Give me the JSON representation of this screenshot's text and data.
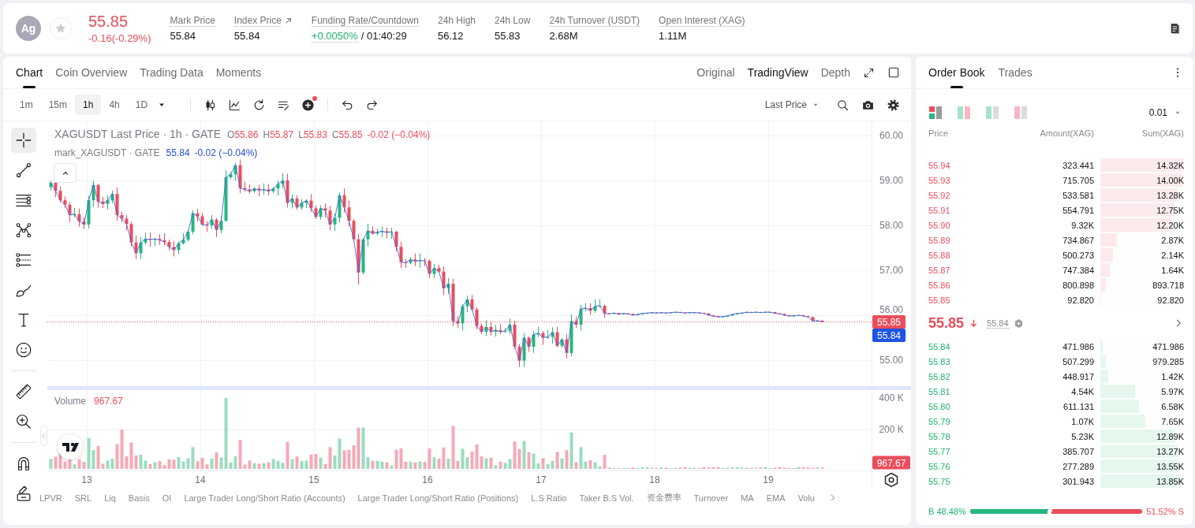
{
  "ticker": {
    "symbol": "Ag",
    "favorited": false,
    "price": "55.85",
    "change": "-0.16(-0.29%)",
    "falling": true
  },
  "stats": [
    {
      "label": "Mark Price",
      "value": "55.84",
      "tooltip": true,
      "kind": "plain"
    },
    {
      "label": "Index Price",
      "value": "55.84",
      "tooltip": true,
      "kind": "link"
    },
    {
      "label": "Funding Rate/Countdown",
      "value": "+0.0050%",
      "countdown": "/ 01:40:29",
      "tooltip": true,
      "kind": "funding"
    },
    {
      "label": "24h High",
      "value": "56.12",
      "tooltip": false,
      "kind": "plain"
    },
    {
      "label": "24h Low",
      "value": "55.83",
      "tooltip": false,
      "kind": "plain"
    },
    {
      "label": "24h Turnover (USDT)",
      "value": "2.68M",
      "tooltip": true,
      "kind": "plain"
    },
    {
      "label": "Open Interest (XAG)",
      "value": "1.11M",
      "tooltip": true,
      "kind": "plain"
    }
  ],
  "chart": {
    "tabs": [
      {
        "label": "Chart",
        "selected": true
      },
      {
        "label": "Coin Overview",
        "selected": false
      },
      {
        "label": "Trading Data",
        "selected": false
      },
      {
        "label": "Moments",
        "selected": false
      }
    ],
    "views": [
      {
        "label": "Original",
        "selected": false
      },
      {
        "label": "TradingView",
        "selected": true
      },
      {
        "label": "Depth",
        "selected": false
      }
    ],
    "intervals": [
      {
        "label": "1m",
        "selected": false
      },
      {
        "label": "15m",
        "selected": false
      },
      {
        "label": "1h",
        "selected": true
      },
      {
        "label": "4h",
        "selected": false
      },
      {
        "label": "1D",
        "selected": false
      }
    ],
    "price_source": "Last Price",
    "tool_groups": [
      {
        "tools": [
          {
            "kind": "crosshair",
            "selected": true
          },
          {
            "kind": "line",
            "selected": false
          },
          {
            "kind": "channel",
            "selected": false
          },
          {
            "kind": "pattern",
            "selected": false
          },
          {
            "kind": "fibonacci",
            "selected": false
          },
          {
            "kind": "brush",
            "selected": false
          },
          {
            "kind": "text",
            "selected": false
          },
          {
            "kind": "emoji",
            "selected": false
          }
        ]
      },
      {
        "tools": [
          {
            "kind": "ruler",
            "selected": false
          },
          {
            "kind": "zoom",
            "selected": false
          }
        ]
      },
      {
        "tools": [
          {
            "kind": "magnet",
            "selected": false
          },
          {
            "kind": "pencil",
            "selected": false
          }
        ]
      }
    ],
    "legend": {
      "title": "XAGUSDT Last Price · 1h · GATE",
      "ohlc": [
        {
          "label": "O",
          "value": "55.86"
        },
        {
          "label": "H",
          "value": "55.87"
        },
        {
          "label": "L",
          "value": "55.83"
        },
        {
          "label": "C",
          "value": "55.85"
        }
      ],
      "change": "-0.02 (−0.04%)"
    },
    "mark_legend": {
      "title": "mark_XAGUSDT · GATE",
      "value": "55.84",
      "change": "-0.02 (−0.04%)"
    },
    "volume_legend": {
      "title": "Volume",
      "value": "967.67"
    },
    "price_axis": [
      "60.00",
      "59.00",
      "58.00",
      "57.00",
      "56.00",
      "55.00"
    ],
    "volume_axis": [
      "400 K",
      "200 K"
    ],
    "time_axis": [
      "13",
      "14",
      "15",
      "16",
      "17",
      "18",
      "19"
    ],
    "price_tags": [
      {
        "kind": "last",
        "value": "55.85"
      },
      {
        "kind": "mark",
        "value": "55.84"
      }
    ],
    "volume_tag": "967.67",
    "indicators": [
      "LPVR",
      "SRL",
      "Liq",
      "Basis",
      "OI",
      "Large Trader Long/Short Ratio (Accounts)",
      "Large Trader Long/Short Ratio (Positions)",
      "L.S Ratio",
      "Taker B.S Vol.",
      "资金费率",
      "Turnover",
      "MA",
      "EMA",
      "Volu"
    ]
  },
  "order_book": {
    "tabs": [
      {
        "label": "Order Book",
        "selected": true
      },
      {
        "label": "Trades",
        "selected": false
      }
    ],
    "view_modes": [
      {
        "kind": "all",
        "selected": true
      },
      {
        "kind": "pair",
        "selected": false
      },
      {
        "kind": "bids",
        "selected": false
      },
      {
        "kind": "asks",
        "selected": false
      }
    ],
    "precision": "0.01",
    "columns": [
      "Price",
      "Amount(XAG)",
      "Sum(XAG)"
    ],
    "asks": [
      {
        "price": "55.94",
        "amount": "323.441",
        "sum": "14.32K",
        "level": 1.0
      },
      {
        "price": "55.93",
        "amount": "715.705",
        "sum": "14.00K",
        "level": 0.978
      },
      {
        "price": "55.92",
        "amount": "533.581",
        "sum": "13.28K",
        "level": 0.927
      },
      {
        "price": "55.91",
        "amount": "554.791",
        "sum": "12.75K",
        "level": 0.89
      },
      {
        "price": "55.90",
        "amount": "9.32K",
        "sum": "12.20K",
        "level": 0.852
      },
      {
        "price": "55.89",
        "amount": "734.867",
        "sum": "2.87K",
        "level": 0.2
      },
      {
        "price": "55.88",
        "amount": "500.273",
        "sum": "2.14K",
        "level": 0.149
      },
      {
        "price": "55.87",
        "amount": "747.384",
        "sum": "1.64K",
        "level": 0.115
      },
      {
        "price": "55.86",
        "amount": "800.898",
        "sum": "893.718",
        "level": 0.062
      },
      {
        "price": "55.85",
        "amount": "92.820",
        "sum": "92.820",
        "level": 0.006
      }
    ],
    "last_price": "55.85",
    "falling": true,
    "mark_price": "55.84",
    "bids": [
      {
        "price": "55.84",
        "amount": "471.986",
        "sum": "471.986",
        "level": 0.033
      },
      {
        "price": "55.83",
        "amount": "507.299",
        "sum": "979.285",
        "level": 0.068
      },
      {
        "price": "55.82",
        "amount": "448.917",
        "sum": "1.42K",
        "level": 0.099
      },
      {
        "price": "55.81",
        "amount": "4.54K",
        "sum": "5.97K",
        "level": 0.417
      },
      {
        "price": "55.80",
        "amount": "611.131",
        "sum": "6.58K",
        "level": 0.46
      },
      {
        "price": "55.79",
        "amount": "1.07K",
        "sum": "7.65K",
        "level": 0.534
      },
      {
        "price": "55.78",
        "amount": "5.23K",
        "sum": "12.89K",
        "level": 0.9
      },
      {
        "price": "55.77",
        "amount": "385.707",
        "sum": "13.27K",
        "level": 0.927
      },
      {
        "price": "55.76",
        "amount": "277.289",
        "sum": "13.55K",
        "level": 0.946
      },
      {
        "price": "55.75",
        "amount": "301.943",
        "sum": "13.85K",
        "level": 0.967
      }
    ],
    "ratio": {
      "buy": "B 48.48%",
      "sell": "51.52% S",
      "level": 0.4848
    }
  }
}
